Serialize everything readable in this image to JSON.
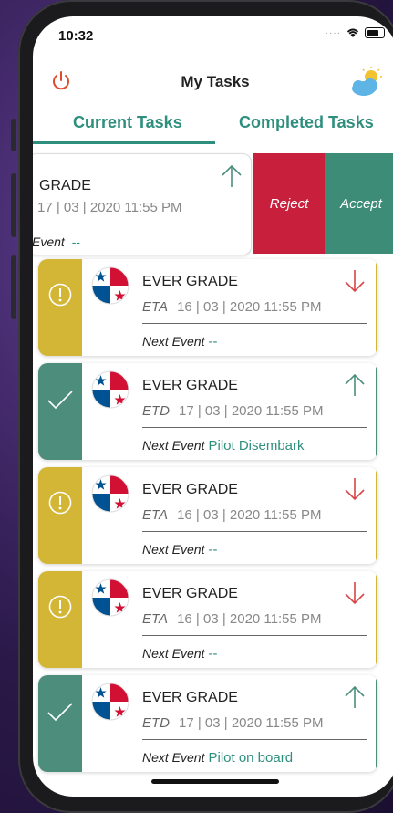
{
  "status": {
    "time": "10:32"
  },
  "header": {
    "title": "My Tasks"
  },
  "tabs": [
    {
      "label": "Current Tasks"
    },
    {
      "label": "Completed Tasks"
    }
  ],
  "swiped_task": {
    "ship": "GRADE",
    "date": "17 | 03 | 2020 11:55 PM",
    "next_label": "Event",
    "next_value": "--",
    "reject_label": "Reject",
    "accept_label": "Accept"
  },
  "tasks": [
    {
      "ship": "EVER GRADE",
      "type": "ETA",
      "date": "16 | 03 | 2020 11:55 PM",
      "next_label": "Next Event",
      "next_value": "--",
      "status": "pending"
    },
    {
      "ship": "EVER GRADE",
      "type": "ETD",
      "date": "17 | 03 | 2020 11:55 PM",
      "next_label": "Next Event",
      "next_value": "Pilot Disembark",
      "status": "confirmed"
    },
    {
      "ship": "EVER GRADE",
      "type": "ETA",
      "date": "16 | 03 | 2020 11:55 PM",
      "next_label": "Next Event",
      "next_value": "--",
      "status": "pending"
    },
    {
      "ship": "EVER GRADE",
      "type": "ETA",
      "date": "16 | 03 | 2020 11:55 PM",
      "next_label": "Next Event",
      "next_value": "--",
      "status": "pending"
    },
    {
      "ship": "EVER GRADE",
      "type": "ETD",
      "date": "17 | 03 | 2020 11:55 PM",
      "next_label": "Next Event",
      "next_value": "Pilot on board",
      "status": "confirmed"
    }
  ],
  "colors": {
    "accent": "#2e8f7e",
    "warning": "#d4b636",
    "confirmed": "#4c8e7b",
    "reject": "#c8203c",
    "accept": "#3c8c78",
    "arrow_down": "#d94545",
    "arrow_up": "#4c8e7b"
  }
}
